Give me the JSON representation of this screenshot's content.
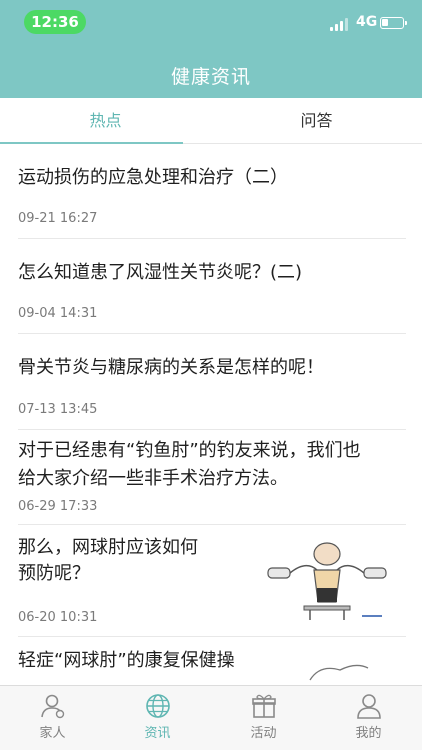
{
  "status_bar": {
    "time": "12:36",
    "network": "4G"
  },
  "header": {
    "title": "健康资讯"
  },
  "tabs": [
    {
      "label": "热点",
      "active": true
    },
    {
      "label": "问答",
      "active": false
    }
  ],
  "articles": [
    {
      "title": "运动损伤的应急处理和治疗（二）",
      "date": "09-21 16:27"
    },
    {
      "title": "怎么知道患了风湿性关节炎呢？(二)",
      "date": "09-04 14:31"
    },
    {
      "title": "骨关节炎与糖尿病的关系是怎样的呢！",
      "date": "07-13 13:45"
    },
    {
      "title_line1": "对于已经患有“钓鱼肘”的钓友来说，我们也",
      "title_line2": "给大家介绍一些非手术治疗方法。",
      "date": "06-29 17:33"
    },
    {
      "title_line1": "那么，网球肘应该如何",
      "title_line2": "预防呢？",
      "date": "06-20 10:31",
      "thumbnail": "exercise-illustration"
    },
    {
      "title": "轻症“网球肘”的康复保健操"
    }
  ],
  "tab_bar": [
    {
      "label": "家人",
      "icon": "family-icon",
      "active": false
    },
    {
      "label": "资讯",
      "icon": "globe-icon",
      "active": true
    },
    {
      "label": "活动",
      "icon": "gift-icon",
      "active": false
    },
    {
      "label": "我的",
      "icon": "user-icon",
      "active": false
    }
  ],
  "colors": {
    "brand": "#7ec7c4",
    "accent": "#5fb6b2",
    "time_pill": "#4cd964"
  }
}
